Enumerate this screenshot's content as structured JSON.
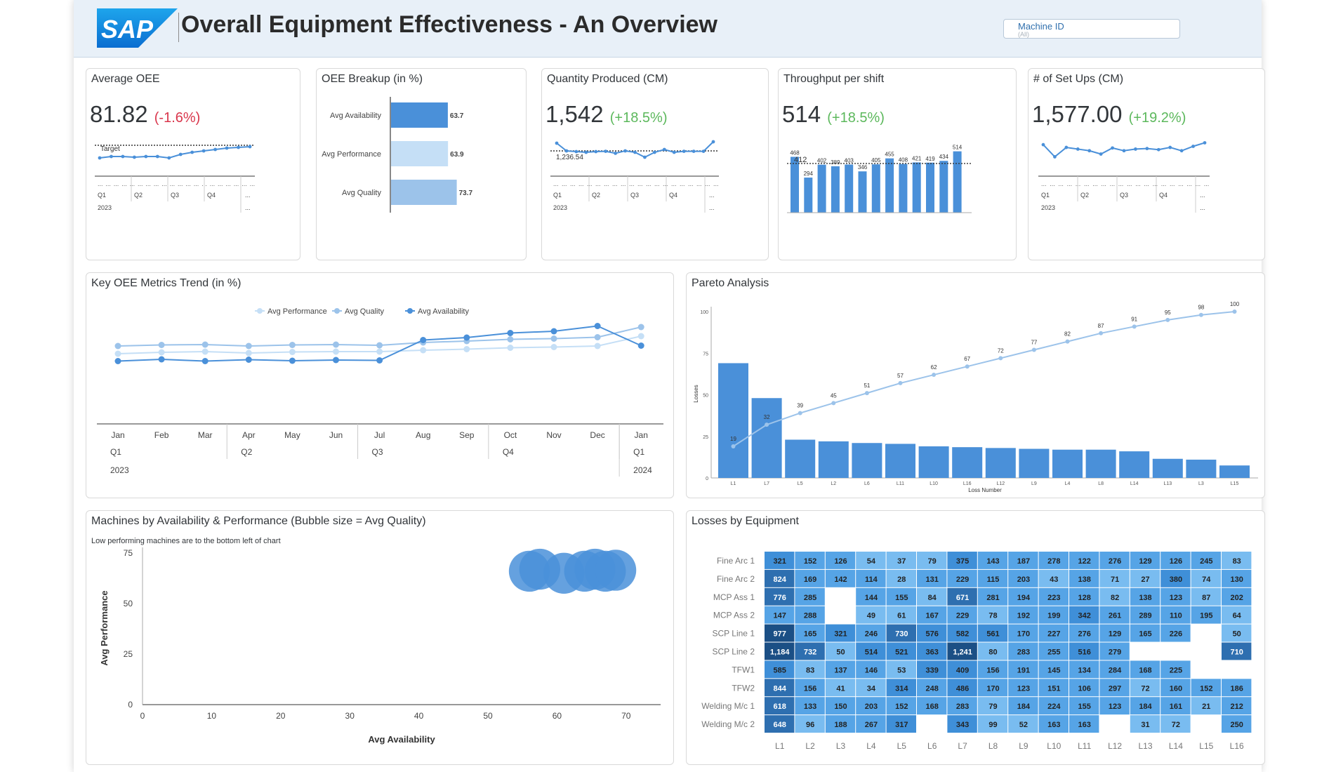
{
  "header": {
    "title": "Overall Equipment Effectiveness - An Overview",
    "logo_text": "SAP",
    "filter": {
      "label": "Machine ID",
      "value": "(All)"
    }
  },
  "colors": {
    "accent": "#4a90d9",
    "light": "#9cc3ea",
    "lighter": "#c5dff6",
    "negative": "#d9364c",
    "positive": "#5cb85c"
  },
  "cards": {
    "avg_oee": {
      "title": "Average OEE",
      "value": "81.82",
      "delta": "(-1.6%)",
      "target_label": "Target",
      "quarters": [
        "Q1",
        "Q2",
        "Q3",
        "Q4"
      ],
      "year": "2023",
      "ellipsis": "..."
    },
    "oee_breakup": {
      "title": "OEE Breakup (in %)"
    },
    "quantity": {
      "title": "Quantity Produced (CM)",
      "value": "1,542",
      "delta": "(+18.5%)",
      "ref_label": "1,236.54",
      "quarters": [
        "Q1",
        "Q2",
        "Q3",
        "Q4"
      ],
      "year": "2023",
      "ellipsis": "..."
    },
    "throughput": {
      "title": "Throughput per shift",
      "value": "514",
      "delta": "(+18.5%)"
    },
    "setups": {
      "title": "# of Set Ups (CM)",
      "value": "1,577.00",
      "delta": "(+19.2%)",
      "quarters": [
        "Q1",
        "Q2",
        "Q3",
        "Q4"
      ],
      "year": "2023",
      "ellipsis": "..."
    },
    "trend": {
      "title": "Key OEE Metrics Trend (in %)"
    },
    "pareto": {
      "title": "Pareto Analysis"
    },
    "bubble": {
      "title": "Machines by Availability & Performance (Bubble size = Avg Quality)",
      "subtitle": "Low performing machines are to the bottom left of chart"
    },
    "losses": {
      "title": "Losses by Equipment"
    }
  },
  "chart_data": [
    {
      "type": "line",
      "name": "avg-oee-sparkline",
      "values": [
        80.8,
        81.0,
        81.0,
        80.9,
        81.0,
        81.0,
        80.8,
        81.3,
        81.6,
        81.8,
        82.0,
        82.2,
        82.3,
        82.4
      ],
      "target": 82.6
    },
    {
      "type": "bar",
      "name": "oee-breakup",
      "categories": [
        "Avg Availability",
        "Avg Performance",
        "Avg Quality"
      ],
      "values": [
        63.7,
        63.9,
        73.7
      ]
    },
    {
      "type": "line",
      "name": "quantity-sparkline",
      "values": [
        1570,
        1515,
        1510,
        1505,
        1510,
        1512,
        1498,
        1515,
        1505,
        1470,
        1505,
        1525,
        1505,
        1512,
        1512,
        1512,
        1580
      ],
      "reference": 1236.54
    },
    {
      "type": "bar",
      "name": "throughput-bars",
      "values": [
        468,
        294,
        402,
        389,
        403,
        346,
        405,
        455,
        408,
        421,
        419,
        434,
        514
      ],
      "target": 412
    },
    {
      "type": "line",
      "name": "setups-sparkline",
      "values": [
        1560,
        1450,
        1535,
        1520,
        1505,
        1475,
        1530,
        1505,
        1520,
        1525,
        1515,
        1535,
        1505,
        1545,
        1577
      ]
    },
    {
      "type": "line",
      "name": "key-oee-trend",
      "x": [
        "Jan",
        "Feb",
        "Mar",
        "Apr",
        "May",
        "Jun",
        "Jul",
        "Aug",
        "Sep",
        "Oct",
        "Nov",
        "Dec",
        "Jan"
      ],
      "quarters": [
        {
          "label": "Q1",
          "start": 0
        },
        {
          "label": "Q2",
          "start": 3
        },
        {
          "label": "Q3",
          "start": 6
        },
        {
          "label": "Q4",
          "start": 9
        },
        {
          "label": "Q1",
          "start": 12
        }
      ],
      "years": [
        {
          "label": "2023",
          "start": 0
        },
        {
          "label": "2024",
          "start": 12
        }
      ],
      "series": [
        {
          "name": "Avg Performance",
          "values": [
            60.0,
            60.4,
            60.6,
            60.2,
            60.5,
            60.6,
            60.6,
            61.0,
            61.3,
            61.7,
            61.9,
            62.2,
            65.0
          ]
        },
        {
          "name": "Avg Quality",
          "values": [
            62.2,
            62.5,
            62.6,
            62.2,
            62.5,
            62.6,
            62.4,
            63.2,
            63.6,
            64.1,
            64.3,
            64.7,
            67.6
          ]
        },
        {
          "name": "Avg Availability",
          "values": [
            57.9,
            58.4,
            57.9,
            58.3,
            58.0,
            58.2,
            58.1,
            63.9,
            64.6,
            65.9,
            66.4,
            67.9,
            62.3
          ]
        }
      ],
      "ylim": [
        45,
        75
      ]
    },
    {
      "type": "bar",
      "name": "pareto",
      "categories": [
        "L1",
        "L7",
        "L5",
        "L2",
        "L6",
        "L11",
        "L10",
        "L16",
        "L12",
        "L9",
        "L4",
        "L8",
        "L14",
        "L13",
        "L3",
        "L15"
      ],
      "values": [
        69,
        48,
        23,
        22,
        21,
        20.5,
        19,
        18.5,
        18,
        17.5,
        17,
        17,
        16,
        11.5,
        11,
        7.5
      ],
      "cumulative": [
        19,
        32,
        39,
        45,
        51,
        57,
        62,
        67,
        72,
        77,
        82,
        87,
        91,
        95,
        98,
        100
      ],
      "yticks": [
        0,
        25,
        50,
        75,
        100
      ],
      "ylabel": "Losses",
      "xlabel": "Loss Number",
      "ylim": [
        0,
        100
      ]
    },
    {
      "type": "scatter",
      "name": "bubble",
      "points": [
        {
          "x": 56,
          "y": 66,
          "size": 73
        },
        {
          "x": 57.5,
          "y": 67,
          "size": 73
        },
        {
          "x": 61,
          "y": 65,
          "size": 73
        },
        {
          "x": 64,
          "y": 66,
          "size": 73
        },
        {
          "x": 65.5,
          "y": 67,
          "size": 73
        },
        {
          "x": 67,
          "y": 66,
          "size": 73
        },
        {
          "x": 68.5,
          "y": 66.5,
          "size": 73
        }
      ],
      "xticks": [
        0,
        10,
        20,
        30,
        40,
        50,
        60,
        70
      ],
      "yticks": [
        0,
        25,
        50,
        75
      ],
      "xlabel": "Avg Availability",
      "ylabel": "Avg Performance",
      "xlim": [
        0,
        75
      ],
      "ylim": [
        0,
        75
      ]
    },
    {
      "type": "heatmap",
      "name": "losses-by-equipment",
      "rows": [
        "Fine Arc 1",
        "Fine Arc 2",
        "MCP Ass 1",
        "MCP Ass 2",
        "SCP Line 1",
        "SCP Line 2",
        "TFW1",
        "TFW2",
        "Welding M/c 1",
        "Welding M/c 2"
      ],
      "cols": [
        "L1",
        "L2",
        "L3",
        "L4",
        "L5",
        "L6",
        "L7",
        "L8",
        "L9",
        "L10",
        "L11",
        "L12",
        "L13",
        "L14",
        "L15",
        "L16"
      ],
      "values": [
        [
          "321",
          "152",
          "126",
          "54",
          "37",
          "79",
          "375",
          "143",
          "187",
          "278",
          "122",
          "276",
          "129",
          "126",
          "245",
          "83"
        ],
        [
          "824",
          "169",
          "142",
          "114",
          "28",
          "131",
          "229",
          "115",
          "203",
          "43",
          "138",
          "71",
          "27",
          "380",
          "74",
          "130"
        ],
        [
          "776",
          "285",
          "",
          "144",
          "155",
          "84",
          "671",
          "281",
          "194",
          "223",
          "128",
          "82",
          "138",
          "123",
          "87",
          "202"
        ],
        [
          "147",
          "288",
          "",
          "49",
          "61",
          "167",
          "229",
          "78",
          "192",
          "199",
          "342",
          "261",
          "289",
          "110",
          "195",
          "64"
        ],
        [
          "977",
          "165",
          "321",
          "246",
          "730",
          "576",
          "582",
          "561",
          "170",
          "227",
          "276",
          "129",
          "165",
          "226",
          "",
          "50"
        ],
        [
          "1,184",
          "732",
          "50",
          "514",
          "521",
          "363",
          "1,241",
          "80",
          "283",
          "255",
          "516",
          "279",
          "",
          "",
          "",
          "710"
        ],
        [
          "585",
          "83",
          "137",
          "146",
          "53",
          "339",
          "409",
          "156",
          "191",
          "145",
          "134",
          "284",
          "168",
          "225",
          "",
          ""
        ],
        [
          "844",
          "156",
          "41",
          "34",
          "314",
          "248",
          "486",
          "170",
          "123",
          "151",
          "106",
          "297",
          "72",
          "160",
          "152",
          "186"
        ],
        [
          "618",
          "133",
          "150",
          "203",
          "152",
          "168",
          "283",
          "79",
          "184",
          "224",
          "155",
          "123",
          "184",
          "161",
          "21",
          "212"
        ],
        [
          "648",
          "96",
          "188",
          "267",
          "317",
          "",
          "343",
          "99",
          "52",
          "163",
          "163",
          "",
          "31",
          "72",
          "",
          "250"
        ]
      ]
    }
  ]
}
